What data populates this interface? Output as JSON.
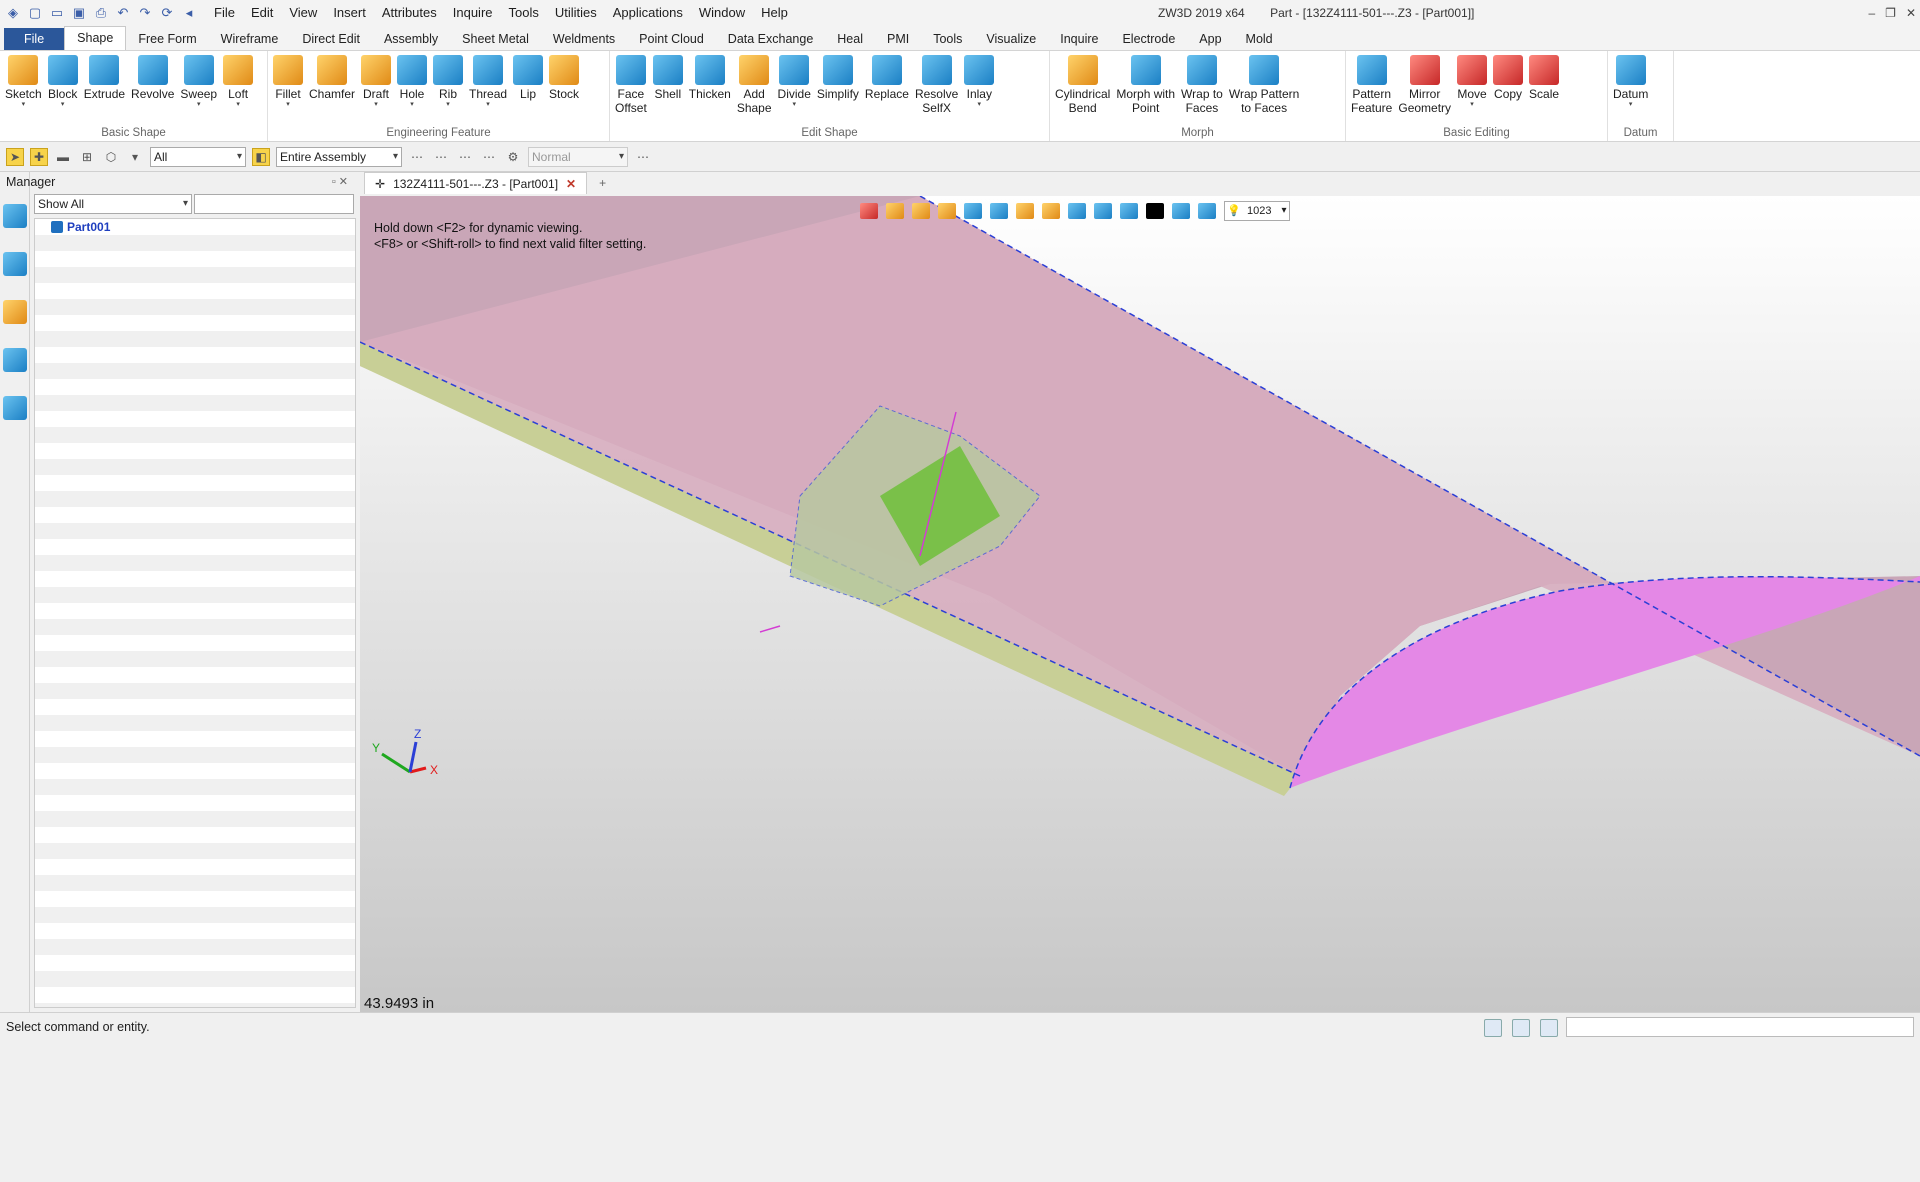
{
  "titlebar": {
    "menu": [
      "File",
      "Edit",
      "View",
      "Insert",
      "Attributes",
      "Inquire",
      "Tools",
      "Utilities",
      "Applications",
      "Window",
      "Help"
    ],
    "app_name": "ZW3D 2019  x64",
    "doc_title": "Part - [132Z4111-501---.Z3 - [Part001]]"
  },
  "ribbon_tabs": [
    "File",
    "Shape",
    "Free Form",
    "Wireframe",
    "Direct Edit",
    "Assembly",
    "Sheet Metal",
    "Weldments",
    "Point Cloud",
    "Data Exchange",
    "Heal",
    "PMI",
    "Tools",
    "Visualize",
    "Inquire",
    "Electrode",
    "App",
    "Mold"
  ],
  "ribbon": {
    "basic_shape": {
      "name": "Basic Shape",
      "buttons": [
        "Sketch",
        "Block",
        "Extrude",
        "Revolve",
        "Sweep",
        "Loft"
      ]
    },
    "engineering_feature": {
      "name": "Engineering Feature",
      "buttons": [
        "Fillet",
        "Chamfer",
        "Draft",
        "Hole",
        "Rib",
        "Thread",
        "Lip",
        "Stock"
      ]
    },
    "edit_shape": {
      "name": "Edit Shape",
      "buttons": [
        "Face\nOffset",
        "Shell",
        "Thicken",
        "Add\nShape",
        "Divide",
        "Simplify",
        "Replace",
        "Resolve\nSelfX",
        "Inlay"
      ]
    },
    "morph": {
      "name": "Morph",
      "buttons": [
        "Cylindrical\nBend",
        "Morph with\nPoint",
        "Wrap to\nFaces",
        "Wrap Pattern\nto Faces"
      ]
    },
    "basic_editing": {
      "name": "Basic Editing",
      "buttons": [
        "Pattern\nFeature",
        "Mirror\nGeometry",
        "Move",
        "Copy",
        "Scale"
      ]
    },
    "datum": {
      "name": "Datum",
      "buttons": [
        "Datum"
      ]
    }
  },
  "filterbar": {
    "filter_value": "All",
    "assembly_value": "Entire Assembly",
    "mode_value": "Normal"
  },
  "manager": {
    "title": "Manager",
    "show_value": "Show All",
    "tree": [
      {
        "label": "Part001"
      }
    ]
  },
  "doc_tab": {
    "label": "132Z4111-501---.Z3 - [Part001]"
  },
  "viewport": {
    "hint_line1": "Hold down <F2> for dynamic viewing.",
    "hint_line2": "<F8> or <Shift-roll> to find next valid filter setting.",
    "count_value": "1023",
    "measurement": "43.9493 in",
    "axes": {
      "x": "X",
      "y": "Y",
      "z": "Z"
    }
  },
  "status": {
    "message": "Select command or entity."
  }
}
